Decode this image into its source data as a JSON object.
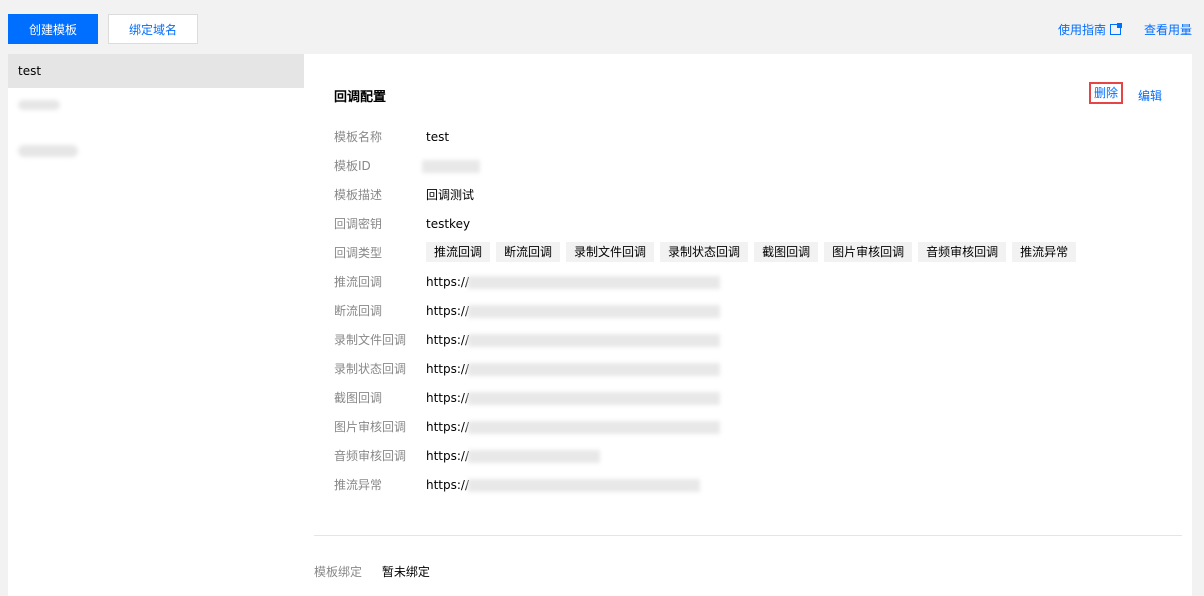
{
  "toolbar": {
    "create_label": "创建模板",
    "bind_domain_label": "绑定域名",
    "guide_label": "使用指南",
    "usage_label": "查看用量"
  },
  "templates": [
    {
      "name": "test"
    }
  ],
  "detail": {
    "section_title": "回调配置",
    "delete_label": "删除",
    "edit_label": "编辑",
    "fields": {
      "name": {
        "label": "模板名称",
        "value": "test"
      },
      "id": {
        "label": "模板ID",
        "value": ""
      },
      "desc": {
        "label": "模板描述",
        "value": "回调测试"
      },
      "key": {
        "label": "回调密钥",
        "value": "testkey"
      },
      "types_label": "回调类型"
    },
    "types": [
      "推流回调",
      "断流回调",
      "录制文件回调",
      "录制状态回调",
      "截图回调",
      "图片审核回调",
      "音频审核回调",
      "推流异常"
    ],
    "urls": [
      {
        "label": "推流回调",
        "value": "https://"
      },
      {
        "label": "断流回调",
        "value": "https://"
      },
      {
        "label": "录制文件回调",
        "value": "https://"
      },
      {
        "label": "录制状态回调",
        "value": "https://"
      },
      {
        "label": "截图回调",
        "value": "https://"
      },
      {
        "label": "图片审核回调",
        "value": "https://"
      },
      {
        "label": "音频审核回调",
        "value": "https://"
      },
      {
        "label": "推流异常",
        "value": "https://"
      }
    ],
    "binding": {
      "label": "模板绑定",
      "value": "暂未绑定"
    }
  },
  "colors": {
    "accent": "#006eff",
    "highlight": "#e54545"
  }
}
